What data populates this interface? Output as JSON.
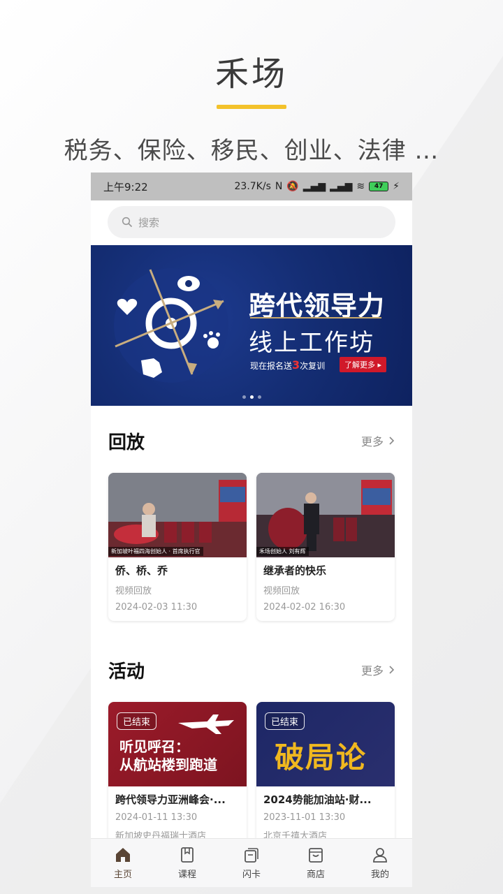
{
  "promo": {
    "title": "禾场",
    "subtitle": "税务、保险、移民、创业、法律 …"
  },
  "statusbar": {
    "time": "上午9:22",
    "speed": "23.7K/s",
    "battery": "47"
  },
  "search": {
    "placeholder": "搜索"
  },
  "banner": {
    "title_line1": "跨代领导力",
    "title_line2": "线上工作坊",
    "tagline_pre": "现在报名送",
    "tagline_num": "3",
    "tagline_post": "次复训",
    "cta": "了解更多 ▸",
    "slide_count": 3,
    "active_slide": 2
  },
  "replay": {
    "title": "回放",
    "more": "更多",
    "items": [
      {
        "title": "侨、桥、乔",
        "type": "视频回放",
        "time": "2024-02-03 11:30",
        "caption": "新加坡叶福四海创始人 · 首席执行官"
      },
      {
        "title": "继承者的快乐",
        "type": "视频回放",
        "time": "2024-02-02 16:30",
        "caption": "禾场创始人 刘有辉"
      }
    ]
  },
  "events": {
    "title": "活动",
    "more": "更多",
    "items": [
      {
        "badge": "已结束",
        "banner_line1": "听见呼召：",
        "banner_line2": "从航站楼到跑道",
        "title": "跨代领导力亚洲峰会·...",
        "time": "2024-01-11 13:30",
        "location": "新加坡史丹福瑞士酒店"
      },
      {
        "badge": "已结束",
        "banner_text": "破局论",
        "title": "2024势能加油站·财...",
        "time": "2023-11-01 13:30",
        "location": "北京千禧大酒店"
      }
    ]
  },
  "tabbar": {
    "items": [
      {
        "label": "主页",
        "icon": "home-icon",
        "active": true
      },
      {
        "label": "课程",
        "icon": "bookmark-icon",
        "active": false
      },
      {
        "label": "闪卡",
        "icon": "cards-icon",
        "active": false
      },
      {
        "label": "商店",
        "icon": "store-icon",
        "active": false
      },
      {
        "label": "我的",
        "icon": "profile-icon",
        "active": false
      }
    ]
  },
  "colors": {
    "accent_yellow": "#f3c22b",
    "banner_blue": "#142d73",
    "cta_red": "#d0192a"
  }
}
